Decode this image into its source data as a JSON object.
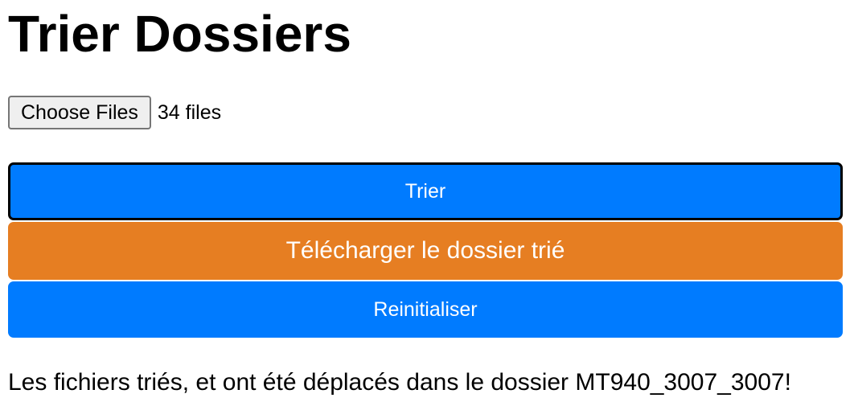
{
  "page": {
    "title": "Trier Dossiers"
  },
  "file_input": {
    "button_label": "Choose Files",
    "status": "34 files"
  },
  "buttons": {
    "sort_label": "Trier",
    "download_label": "Télécharger le dossier trié",
    "reset_label": "Reinitialiser"
  },
  "message": {
    "text": "Les fichiers triés, et ont été déplacés dans le dossier MT940_3007_3007!"
  },
  "colors": {
    "primary": "#007bff",
    "download": "#e67e22",
    "text": "#000000",
    "background": "#ffffff"
  }
}
